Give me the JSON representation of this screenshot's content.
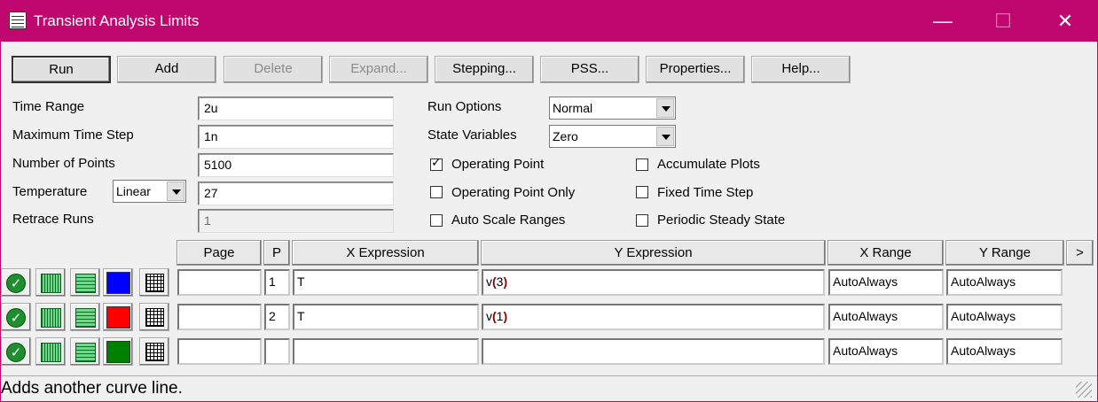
{
  "window": {
    "title": "Transient Analysis Limits",
    "min_glyph": "—",
    "max_glyph": "☐",
    "close_glyph": "✕"
  },
  "toolbar": {
    "run": "Run",
    "add": "Add",
    "delete": "Delete",
    "expand": "Expand...",
    "stepping": "Stepping...",
    "pss": "PSS...",
    "properties": "Properties...",
    "help": "Help..."
  },
  "fields": {
    "time_range_label": "Time Range",
    "time_range": "2u",
    "max_time_step_label": "Maximum Time Step",
    "max_time_step": "1n",
    "num_points_label": "Number of Points",
    "num_points": "5100",
    "temperature_label": "Temperature",
    "temperature_mode": "Linear",
    "temperature": "27",
    "retrace_label": "Retrace Runs",
    "retrace": "1"
  },
  "options": {
    "run_options_label": "Run Options",
    "run_options": "Normal",
    "state_vars_label": "State Variables",
    "state_vars": "Zero",
    "checkboxes": [
      {
        "label": "Operating Point",
        "checked": true
      },
      {
        "label": "Operating Point Only",
        "checked": false
      },
      {
        "label": "Auto Scale Ranges",
        "checked": false
      },
      {
        "label": "Accumulate Plots",
        "checked": false
      },
      {
        "label": "Fixed Time Step",
        "checked": false
      },
      {
        "label": "Periodic Steady State",
        "checked": false
      }
    ]
  },
  "table": {
    "headers": {
      "page": "Page",
      "p": "P",
      "x_expr": "X Expression",
      "y_expr": "Y Expression",
      "x_range": "X Range",
      "y_range": "Y Range",
      "more": ">"
    },
    "rows": [
      {
        "color": "#0000ff",
        "page": "",
        "p": "1",
        "x": "T",
        "y_fn": "v",
        "y_arg": "3",
        "x_range": "AutoAlways",
        "y_range": "AutoAlways"
      },
      {
        "color": "#ff0000",
        "page": "",
        "p": "2",
        "x": "T",
        "y_fn": "v",
        "y_arg": "1",
        "x_range": "AutoAlways",
        "y_range": "AutoAlways"
      },
      {
        "color": "#008000",
        "page": "",
        "p": "",
        "x": "",
        "y_fn": "",
        "y_arg": "",
        "x_range": "AutoAlways",
        "y_range": "AutoAlways"
      }
    ]
  },
  "status": "Adds another curve line."
}
